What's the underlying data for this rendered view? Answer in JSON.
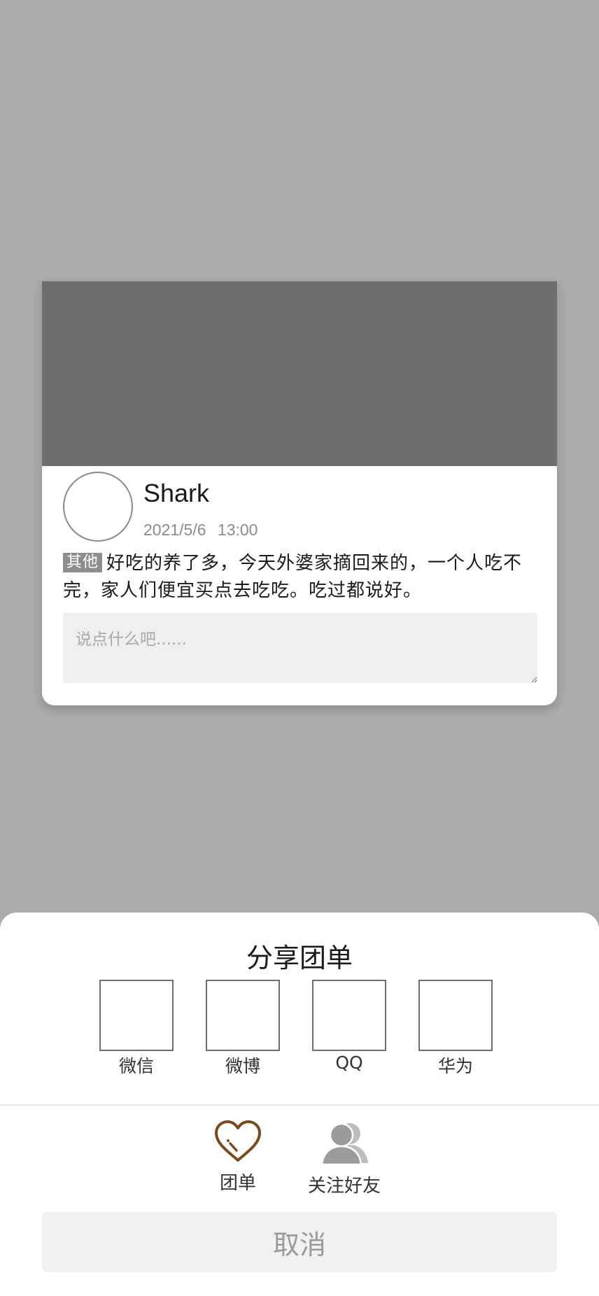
{
  "post": {
    "username": "Shark",
    "timestamp": "2021/5/6 13:00",
    "tag": "其他",
    "content": "好吃的养了多，今天外婆家摘回来的，一个人吃不完，家人们便宜买点去吃吃。吃过都说好。",
    "comment_placeholder": "说点什么吧......"
  },
  "share_sheet": {
    "title": "分享团单",
    "targets": [
      {
        "label": "微信"
      },
      {
        "label": "微博"
      },
      {
        "label": "QQ"
      },
      {
        "label": "华为"
      }
    ],
    "actions": [
      {
        "label": "团单",
        "icon": "heart-icon"
      },
      {
        "label": "关注好友",
        "icon": "friends-icon"
      }
    ],
    "cancel_label": "取消"
  },
  "colors": {
    "overlay": "#ababab",
    "image_placeholder": "#6e6e6e",
    "heart_icon": "#7a4a1c",
    "friends_icon": "#9b9b9b"
  }
}
